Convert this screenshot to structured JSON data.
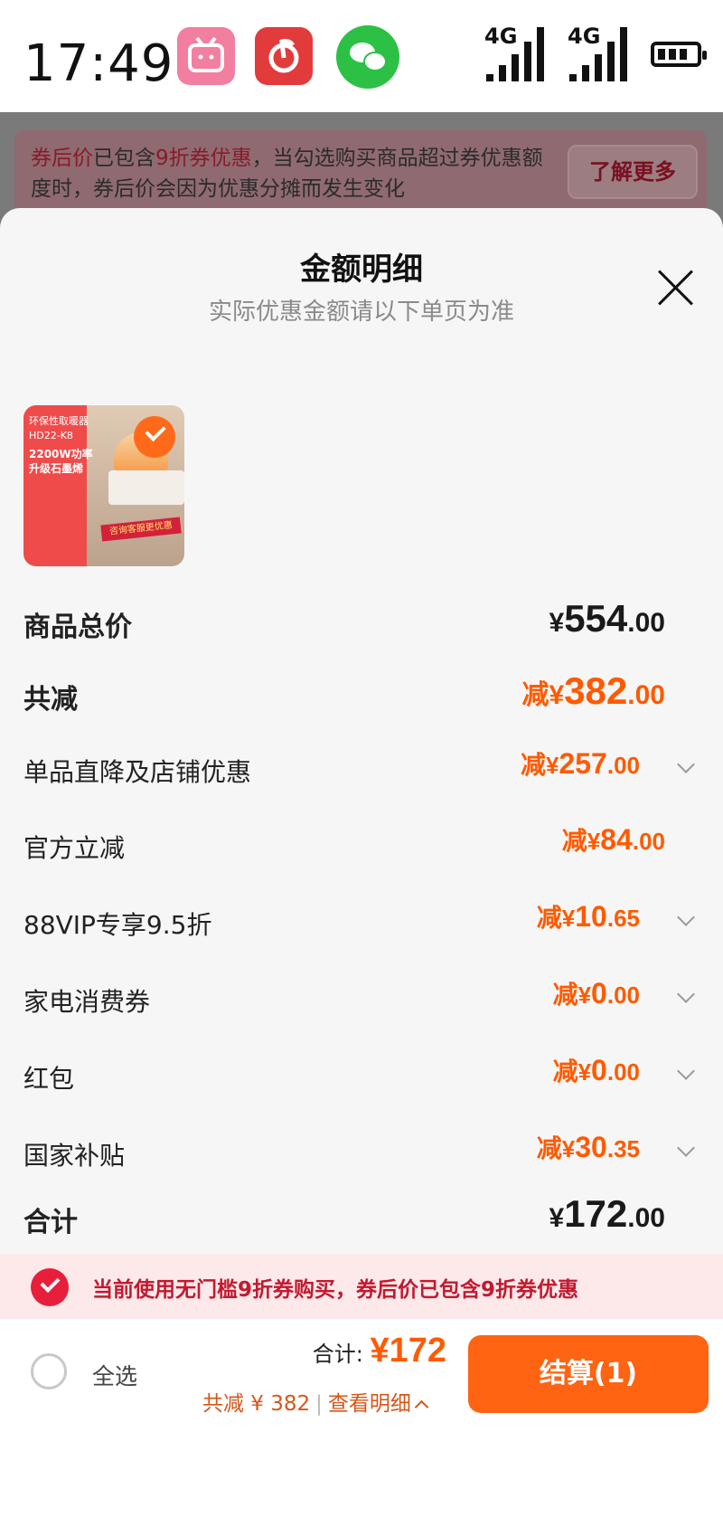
{
  "status_bar": {
    "time": "17:49",
    "signal1_label": "4G",
    "signal2_label": "4G"
  },
  "background": {
    "promo_highlight": "券后价",
    "promo_text_mid": "已包含",
    "promo_highlight2": "9折券优惠",
    "promo_text_rest": "，当勾选购买商品超过券优惠额度时，券后价会因为优惠分摊而发生变化",
    "learn_more": "了解更多"
  },
  "sheet": {
    "title": "金额明细",
    "subtitle": "实际优惠金额请以下单页为准",
    "product": {
      "thumb_lines": [
        "环保性取暖器",
        "HD22-K8",
        "2200W功率",
        "升级石墨烯"
      ],
      "thumb_cta": "咨询客服更优惠"
    },
    "rows": [
      {
        "label": "商品总价",
        "prefix": "",
        "currency": "¥",
        "int": "554",
        "dec": ".00"
      },
      {
        "label": "共减",
        "prefix": "减",
        "currency": "¥",
        "int": "382",
        "dec": ".00"
      },
      {
        "label": "单品直降及店铺优惠",
        "prefix": "减",
        "currency": "¥",
        "int": "257",
        "dec": ".00"
      },
      {
        "label": "官方立减",
        "prefix": "减",
        "currency": "¥",
        "int": "84",
        "dec": ".00"
      },
      {
        "label": "88VIP专享9.5折",
        "prefix": "减",
        "currency": "¥",
        "int": "10",
        "dec": ".65"
      },
      {
        "label": "家电消费券",
        "prefix": "减",
        "currency": "¥",
        "int": "0",
        "dec": ".00"
      },
      {
        "label": "红包",
        "prefix": "减",
        "currency": "¥",
        "int": "0",
        "dec": ".00"
      },
      {
        "label": "国家补贴",
        "prefix": "减",
        "currency": "¥",
        "int": "30",
        "dec": ".35"
      },
      {
        "label": "合计",
        "prefix": "",
        "currency": "¥",
        "int": "172",
        "dec": ".00"
      }
    ]
  },
  "notice": {
    "text": "当前使用无门槛9折券购买，券后价已包含9折券优惠"
  },
  "bottom_bar": {
    "select_all": "全选",
    "total_label": "合计: ",
    "total_amount": "¥172",
    "saved_text": "共减 ¥ 382",
    "separator": "|",
    "view_detail": "查看明细",
    "checkout": "结算(1)"
  },
  "colors": {
    "accent": "#ff5a00",
    "checkout": "#ff6412",
    "notice_red": "#c3192f"
  }
}
